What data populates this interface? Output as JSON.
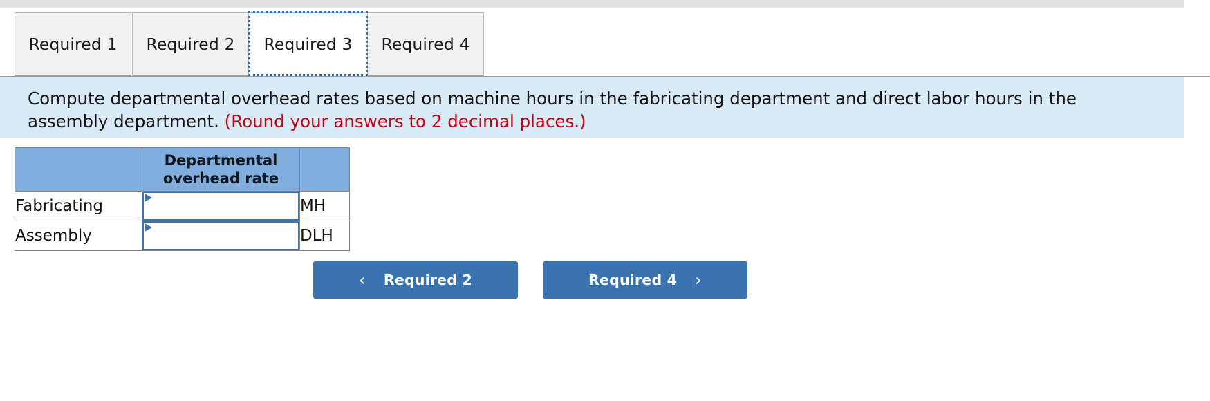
{
  "window": {
    "top_strip_color": "#e2e2e2"
  },
  "tabs": {
    "items": [
      {
        "label": "Required 1",
        "active": false
      },
      {
        "label": "Required 2",
        "active": false
      },
      {
        "label": "Required 3",
        "active": true
      },
      {
        "label": "Required 4",
        "active": false
      }
    ],
    "active_index": 2,
    "focus_outline_color": "#2c6fb5"
  },
  "banner": {
    "background_color": "#d9eaf7",
    "instruction": "Compute departmental overhead rates based on machine hours in the fabricating department and direct labor hours in the assembly department. ",
    "round_note": "(Round your answers to 2 decimal places.)",
    "round_note_color": "#c00014"
  },
  "answer_table": {
    "header_background": "#7fadde",
    "headers": [
      "",
      "Departmental overhead rate",
      ""
    ],
    "header_rate_line1": "Departmental",
    "header_rate_line2": "overhead rate",
    "rows": [
      {
        "label": "Fabricating",
        "rate_value": "",
        "rate_placeholder": "",
        "unit": "MH"
      },
      {
        "label": "Assembly",
        "rate_value": "",
        "rate_placeholder": "",
        "unit": "DLH"
      }
    ],
    "input_border_color": "#3b73b0"
  },
  "navigation": {
    "prev_label": "Required 2",
    "next_label": "Required 4",
    "prev_icon": "chevron-left-icon",
    "next_icon": "chevron-right-icon",
    "prev_glyph": "‹",
    "next_glyph": "›",
    "button_color": "#3b73b0"
  }
}
